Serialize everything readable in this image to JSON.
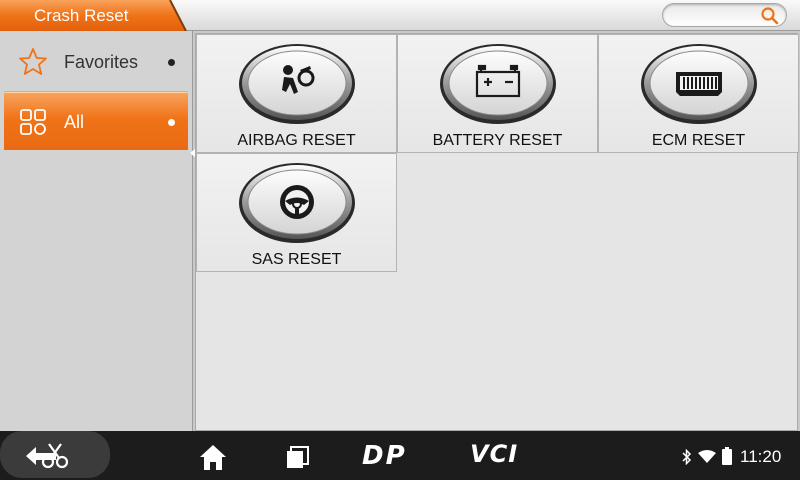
{
  "header": {
    "title": "Crash Reset",
    "search_icon": "search-icon"
  },
  "sidebar": {
    "items": [
      {
        "label": "Favorites",
        "icon": "star-icon",
        "selected": false
      },
      {
        "label": "All",
        "icon": "grid-icon",
        "selected": true
      }
    ]
  },
  "main": {
    "tiles": [
      {
        "label": "AIRBAG RESET",
        "icon": "airbag-icon"
      },
      {
        "label": "BATTERY RESET",
        "icon": "battery-icon"
      },
      {
        "label": "ECM RESET",
        "icon": "ecm-connector-icon"
      },
      {
        "label": "SAS RESET",
        "icon": "steering-wheel-icon"
      }
    ]
  },
  "navbar": {
    "items": [
      "back-icon",
      "scissors-icon",
      "home-icon",
      "recent-apps-icon",
      "dp-logo",
      "vci-logo"
    ],
    "dp_text": "DP",
    "vci_text": "VCI"
  },
  "status": {
    "time": "11:20",
    "icons": [
      "bluetooth-icon",
      "wifi-icon",
      "battery-status-icon"
    ]
  },
  "colors": {
    "accent": "#f07318",
    "nav_background": "#1c1c1c",
    "content_background": "#e5e5e5"
  }
}
